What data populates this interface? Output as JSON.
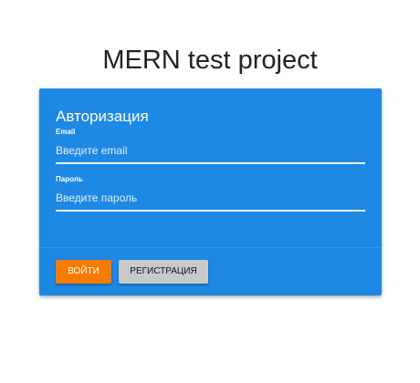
{
  "page": {
    "title": "MERN test project"
  },
  "auth_card": {
    "title": "Авторизация",
    "email": {
      "label": "Email",
      "placeholder": "Введите email",
      "value": ""
    },
    "password": {
      "label": "Пароль",
      "placeholder": "Введите пароль",
      "value": ""
    },
    "buttons": {
      "login": "ВОЙТИ",
      "register": "РЕГИСТРАЦИЯ"
    }
  },
  "colors": {
    "card_background": "#1e88e5",
    "login_button": "#f57c00",
    "register_button": "#c9c9c9",
    "text_on_card": "#ffffff"
  }
}
